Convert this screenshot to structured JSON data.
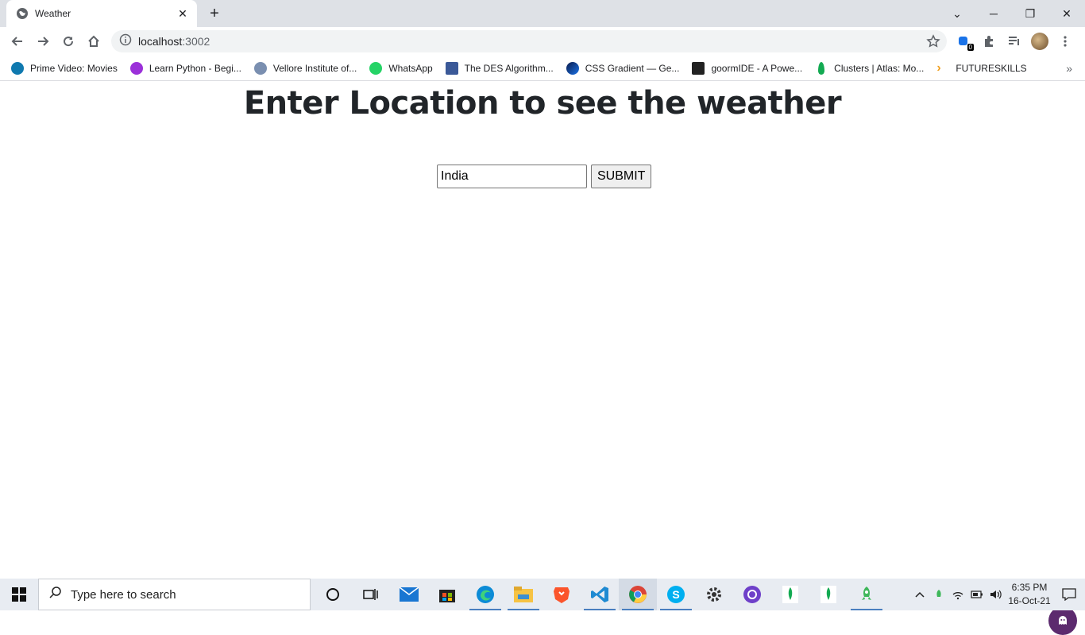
{
  "browser": {
    "tab_title": "Weather",
    "url_host": "localhost",
    "url_port": ":3002",
    "ext_badge": "0"
  },
  "bookmarks": [
    {
      "label": "Prime Video: Movies",
      "color": "#0f79af"
    },
    {
      "label": "Learn Python - Begi...",
      "color": "#9b30d9"
    },
    {
      "label": "Vellore Institute of...",
      "color": "#7a8fb0"
    },
    {
      "label": "WhatsApp",
      "color": "#25d366"
    },
    {
      "label": "The DES Algorithm...",
      "color": "#3b5998"
    },
    {
      "label": "CSS Gradient — Ge...",
      "color": "#1a3b8c"
    },
    {
      "label": "goormIDE - A Powe...",
      "color": "#222222"
    },
    {
      "label": "Clusters | Atlas: Mo...",
      "color": "#13aa52"
    },
    {
      "label": "FUTURESKILLS",
      "color": "#f0a020"
    }
  ],
  "page": {
    "heading": "Enter Location to see the weather",
    "location_value": "India",
    "submit_label": "SUBMIT"
  },
  "taskbar": {
    "search_placeholder": "Type here to search",
    "time": "6:35 PM",
    "date": "16-Oct-21"
  }
}
